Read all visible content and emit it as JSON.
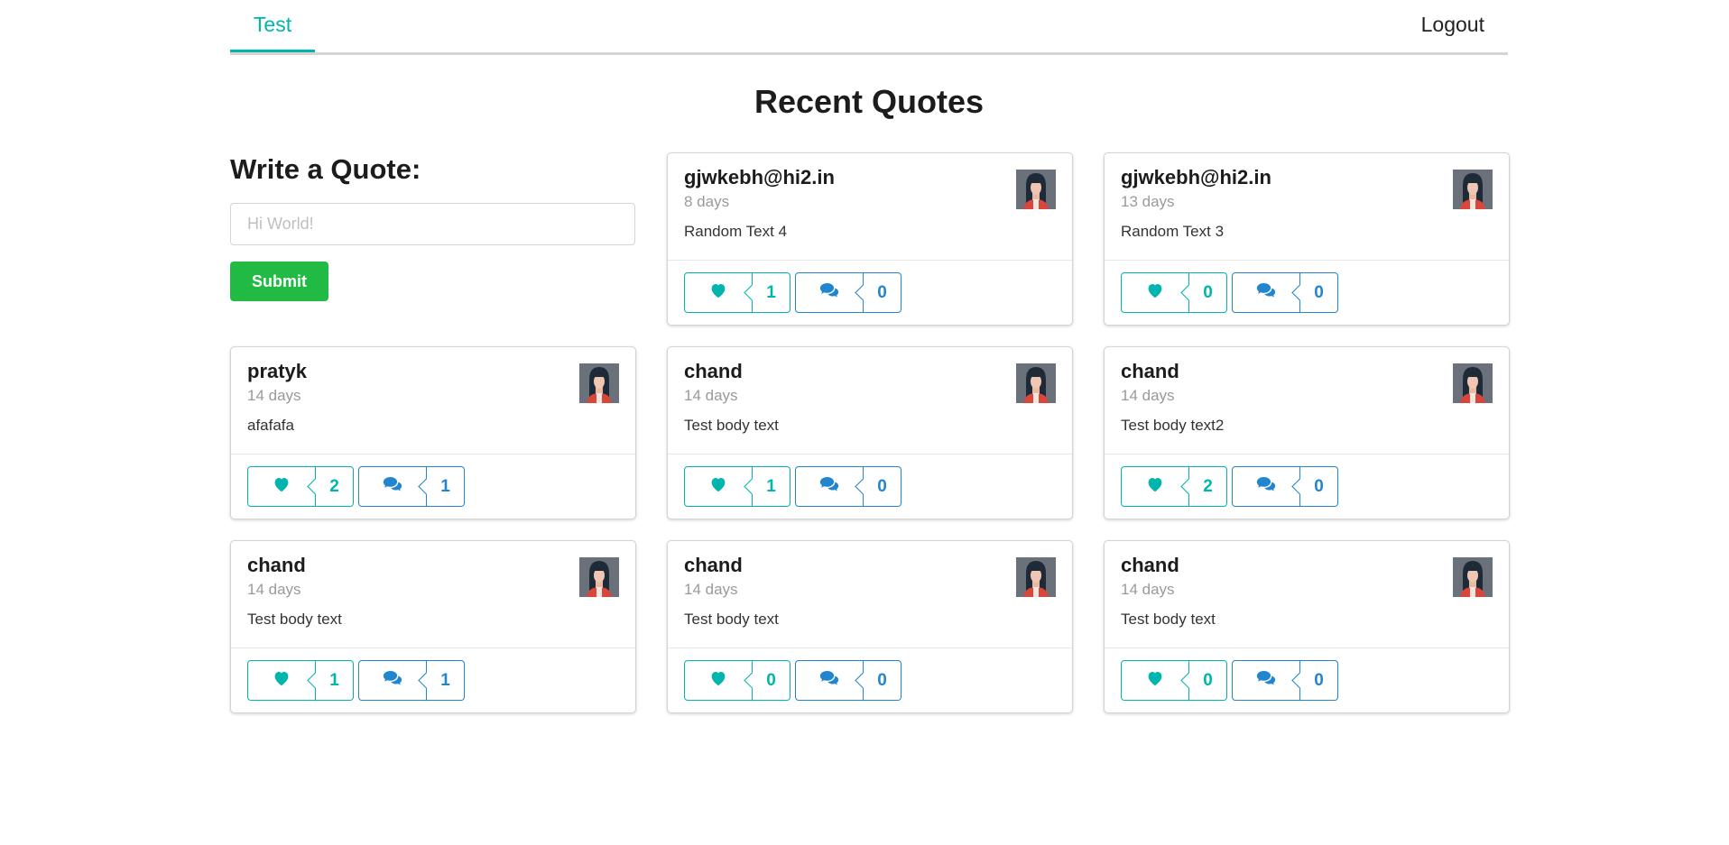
{
  "nav": {
    "brand": "Test",
    "logout": "Logout"
  },
  "page_title": "Recent Quotes",
  "form": {
    "title": "Write a Quote:",
    "placeholder": "Hi World!",
    "value": "",
    "submit": "Submit"
  },
  "colors": {
    "like": "#00b5ad",
    "comment": "#2185d0",
    "submit": "#21ba45"
  },
  "quotes": [
    {
      "author": "gjwkebh@hi2.in",
      "age": "8 days",
      "text": "Random Text 4",
      "likes": "1",
      "comments": "0"
    },
    {
      "author": "gjwkebh@hi2.in",
      "age": "13 days",
      "text": "Random Text 3",
      "likes": "0",
      "comments": "0"
    },
    {
      "author": "pratyk",
      "age": "14 days",
      "text": "afafafa",
      "likes": "2",
      "comments": "1"
    },
    {
      "author": "chand",
      "age": "14 days",
      "text": "Test body text",
      "likes": "1",
      "comments": "0"
    },
    {
      "author": "chand",
      "age": "14 days",
      "text": "Test body text2",
      "likes": "2",
      "comments": "0"
    },
    {
      "author": "chand",
      "age": "14 days",
      "text": "Test body text",
      "likes": "1",
      "comments": "1"
    },
    {
      "author": "chand",
      "age": "14 days",
      "text": "Test body text",
      "likes": "0",
      "comments": "0"
    },
    {
      "author": "chand",
      "age": "14 days",
      "text": "Test body text",
      "likes": "0",
      "comments": "0"
    }
  ]
}
